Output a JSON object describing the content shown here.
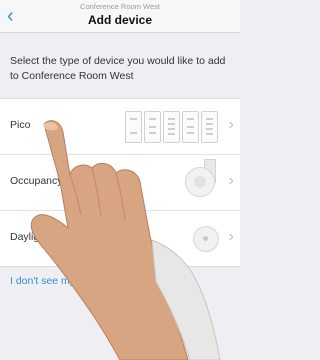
{
  "nav": {
    "subtitle": "Conference Room West",
    "title": "Add device"
  },
  "prompt": "Select the type of device you would like to add to Conference Room West",
  "devices": [
    {
      "label": "Pico",
      "icon": "pico-remote-icon"
    },
    {
      "label": "Occupancy Sensor",
      "icon": "occupancy-sensor-icon"
    },
    {
      "label": "Daylight Sensor",
      "icon": "daylight-sensor-icon"
    }
  ],
  "help_link": "I don't see my devices in my room/area"
}
